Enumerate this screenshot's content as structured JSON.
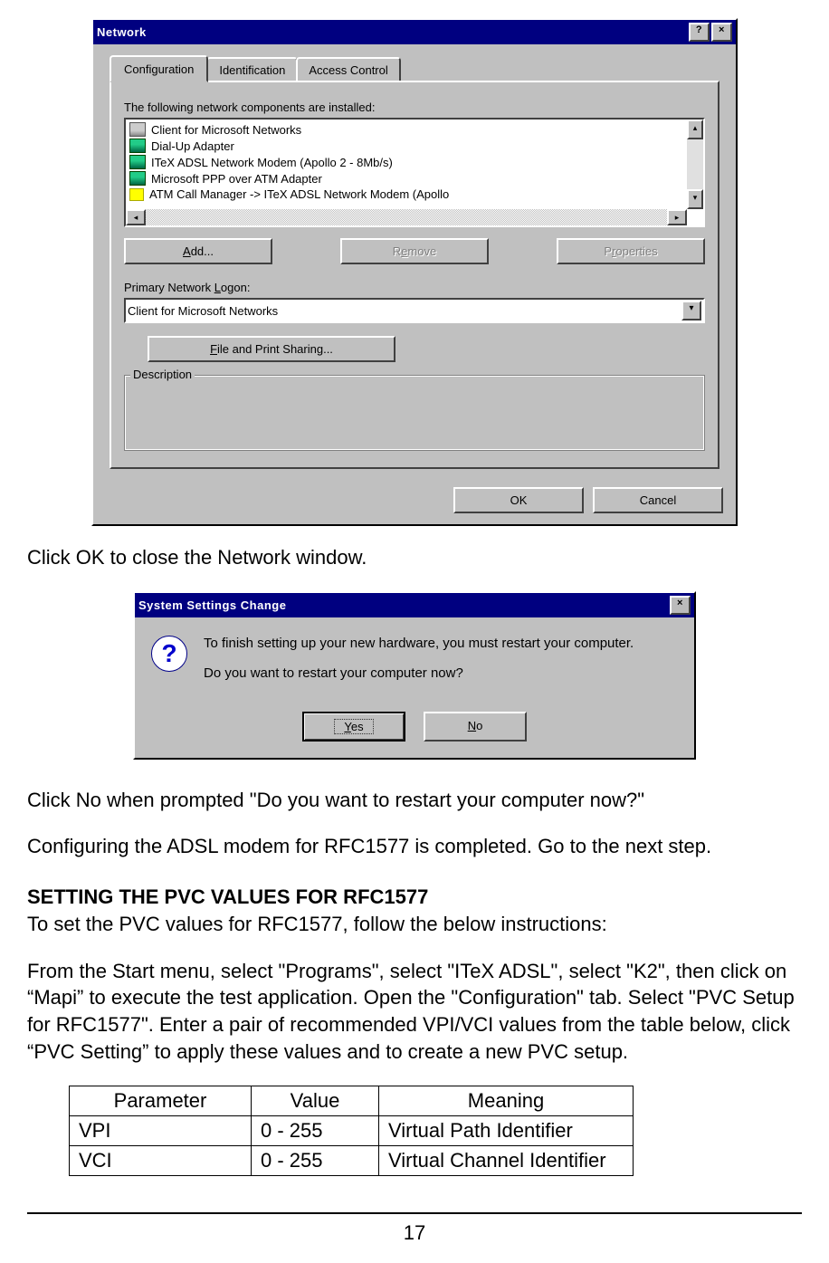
{
  "networkDialog": {
    "title": "Network",
    "tabs": {
      "config": "Configuration",
      "ident": "Identification",
      "access": "Access Control"
    },
    "installed_label": "The following network components are installed:",
    "components": [
      "Client for Microsoft Networks",
      "Dial-Up Adapter",
      "ITeX ADSL Network Modem (Apollo 2 - 8Mb/s)",
      "Microsoft PPP over ATM Adapter",
      "ATM Call Manager -> ITeX ADSL Network Modem (Apollo"
    ],
    "add_btn": "Add...",
    "remove_btn": "Remove",
    "props_btn": "Properties",
    "logon_label": "Primary Network Logon:",
    "logon_value": "Client for Microsoft Networks",
    "fps_btn": "File and Print Sharing...",
    "desc_label": "Description",
    "ok": "OK",
    "cancel": "Cancel"
  },
  "doc": {
    "p1": "Click OK to close the Network window.",
    "p2": "Click No when prompted \"Do you want to restart your computer now?\"",
    "p3": "Configuring the ADSL modem for RFC1577 is completed.  Go to the next step.",
    "h2": "SETTING THE PVC VALUES FOR RFC1577",
    "p4": "To set the PVC values for RFC1577, follow the below instructions:",
    "p5": "From the Start menu, select \"Programs\", select \"ITeX ADSL\", select \"K2\", then click on “Mapi” to execute the test application.  Open the \"Configuration\" tab.  Select \"PVC Setup for RFC1577\".  Enter a pair of recommended VPI/VCI values from the table below, click “PVC Setting” to apply these values and to create a new PVC setup.",
    "page": "17"
  },
  "restartDialog": {
    "title": "System Settings Change",
    "line1": "To finish setting up your new hardware, you must restart your computer.",
    "line2": "Do you want to restart your computer now?",
    "yes": "Yes",
    "no": "No"
  },
  "table": {
    "h1": "Parameter",
    "h2": "Value",
    "h3": "Meaning",
    "r1c1": "VPI",
    "r1c2": "0 - 255",
    "r1c3": "Virtual Path Identifier",
    "r2c1": "VCI",
    "r2c2": "0 - 255",
    "r2c3": "Virtual Channel Identifier"
  }
}
